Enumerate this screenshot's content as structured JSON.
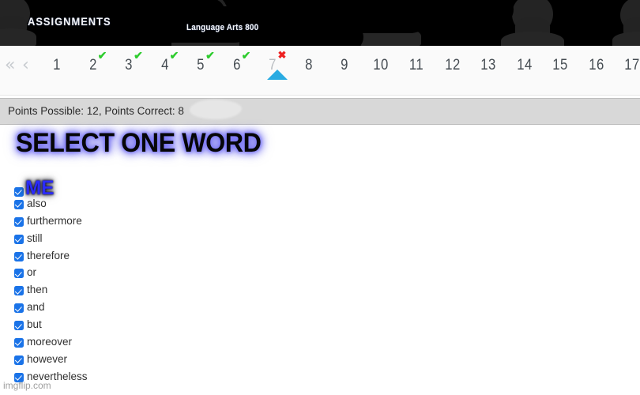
{
  "header": {
    "title": "ASSIGNMENTS",
    "course": "Language Arts 800"
  },
  "pager": {
    "first_icon": "«",
    "prev_icon": "‹",
    "check_icon": "✔",
    "cross_icon": "✖",
    "current_page": 7,
    "pages": [
      {
        "label": "1",
        "status": "none"
      },
      {
        "label": "2",
        "status": "correct"
      },
      {
        "label": "3",
        "status": "correct"
      },
      {
        "label": "4",
        "status": "correct"
      },
      {
        "label": "5",
        "status": "correct"
      },
      {
        "label": "6",
        "status": "correct"
      },
      {
        "label": "7",
        "status": "incorrect"
      },
      {
        "label": "8",
        "status": "none"
      },
      {
        "label": "9",
        "status": "none"
      },
      {
        "label": "10",
        "status": "none"
      },
      {
        "label": "11",
        "status": "none"
      },
      {
        "label": "12",
        "status": "none"
      },
      {
        "label": "13",
        "status": "none"
      },
      {
        "label": "14",
        "status": "none"
      },
      {
        "label": "15",
        "status": "none"
      },
      {
        "label": "16",
        "status": "none"
      },
      {
        "label": "17",
        "status": "none"
      }
    ]
  },
  "points": {
    "text": "Points Possible: 12,  Points Correct: 8",
    "possible": 12,
    "correct": 8
  },
  "question": {
    "prompt": "SELECT ONE WORD",
    "options": [
      {
        "label": "ME",
        "checked": true,
        "highlight": true
      },
      {
        "label": "also",
        "checked": true,
        "highlight": false
      },
      {
        "label": "furthermore",
        "checked": true,
        "highlight": false
      },
      {
        "label": "still",
        "checked": true,
        "highlight": false
      },
      {
        "label": "therefore",
        "checked": true,
        "highlight": false
      },
      {
        "label": "or",
        "checked": true,
        "highlight": false
      },
      {
        "label": "then",
        "checked": true,
        "highlight": false
      },
      {
        "label": "and",
        "checked": true,
        "highlight": false
      },
      {
        "label": "but",
        "checked": true,
        "highlight": false
      },
      {
        "label": "moreover",
        "checked": true,
        "highlight": false
      },
      {
        "label": "however",
        "checked": true,
        "highlight": false
      },
      {
        "label": "nevertheless",
        "checked": true,
        "highlight": false
      }
    ]
  },
  "watermark": "imgflip.com",
  "colors": {
    "correct_green": "#2ecc2e",
    "incorrect_red": "#ee2020",
    "pointer_blue": "#29abe2",
    "checkbox_blue": "#1a73e8",
    "highlight_blue": "#2b2bff",
    "glow_purple": "#5a56e8",
    "header_black": "#000000",
    "points_bar_gray": "#d8d8d8"
  }
}
